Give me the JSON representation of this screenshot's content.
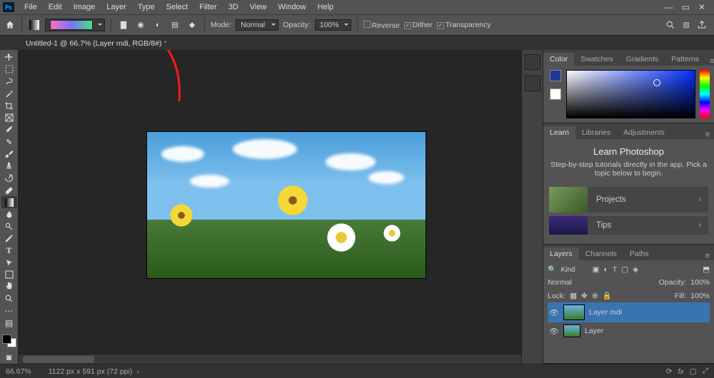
{
  "menubar": {
    "items": [
      "File",
      "Edit",
      "Image",
      "Layer",
      "Type",
      "Select",
      "Filter",
      "3D",
      "View",
      "Window",
      "Help"
    ]
  },
  "optbar": {
    "mode_label": "Mode:",
    "mode_value": "Normal",
    "opacity_label": "Opacity:",
    "opacity_value": "100%",
    "reverse": "Reverse",
    "dither": "Dither",
    "transparency": "Transparency"
  },
  "tab": {
    "title": "Untitled-1 @ 66.7% (Layer mdi, RGB/8#)"
  },
  "panels": {
    "color_tabs": [
      "Color",
      "Swatches",
      "Gradients",
      "Patterns"
    ],
    "learn_tabs": [
      "Learn",
      "Libraries",
      "Adjustments"
    ],
    "learn_title": "Learn Photoshop",
    "learn_sub": "Step-by-step tutorials directly in the app. Pick a topic below to begin.",
    "learn_items": [
      "Projects",
      "Tips"
    ],
    "layers_tabs": [
      "Layers",
      "Channels",
      "Paths"
    ]
  },
  "layers_panel": {
    "filter_label": "Kind",
    "blend": "Normal",
    "opacity_label": "Opacity:",
    "opacity": "100%",
    "lock_label": "Lock:",
    "fill_label": "Fill:",
    "fill": "100%",
    "items": [
      {
        "name": "Layer mdi"
      },
      {
        "name": "Layer"
      }
    ]
  },
  "status": {
    "zoom": "66.67%",
    "size": "1122 px x 591 px (72 ppi)"
  }
}
